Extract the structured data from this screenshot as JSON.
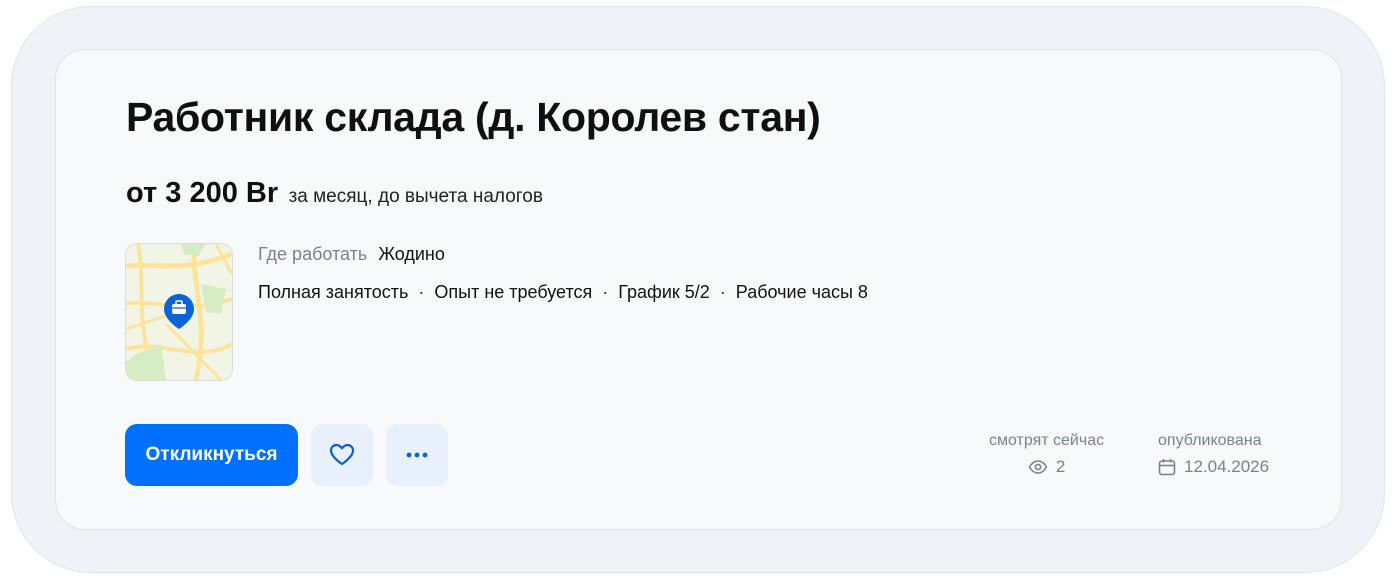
{
  "vacancy": {
    "title": "Работник склада (д. Королев стан)",
    "salary": "от 3 200 Br",
    "salary_note": "за месяц, до вычета налогов",
    "where_label": "Где работать",
    "where_value": "Жодино",
    "tags": [
      "Полная занятость",
      "Опыт не требуется",
      "График 5/2",
      "Рабочие часы 8"
    ],
    "separator": "·"
  },
  "actions": {
    "apply_label": "Откликнуться",
    "favorite_icon": "heart-icon",
    "more_icon": "more-dots-icon"
  },
  "stats": {
    "views_label": "смотрят сейчас",
    "views_value": "2",
    "views_icon": "eye-icon",
    "published_label": "опубликована",
    "published_value": "12.04.2026",
    "published_icon": "calendar-icon"
  },
  "colors": {
    "accent": "#0070ff",
    "secondary_button_bg": "#e8f0fb",
    "card_bg": "#f7f9fb",
    "outer_bg": "#eff2f6",
    "muted_text": "#7a828c"
  }
}
